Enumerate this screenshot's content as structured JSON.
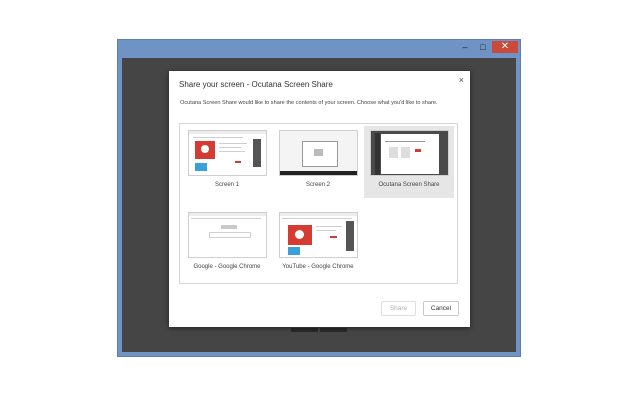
{
  "window": {
    "controls": {
      "minimize": "–",
      "maximize": "□",
      "close": "✕"
    }
  },
  "dialog": {
    "title": "Share your screen - Ocutana Screen Share",
    "close_glyph": "×",
    "description": "Ocutana Screen Share would like to share the contents of your screen. Choose what you'd like to share.",
    "sources": [
      {
        "label": "Screen 1",
        "selected": false
      },
      {
        "label": "Screen 2",
        "selected": false
      },
      {
        "label": "Ocutana Screen Share",
        "selected": true
      },
      {
        "label": "Google - Google Chrome",
        "selected": false
      },
      {
        "label": "YouTube - Google Chrome",
        "selected": false
      }
    ],
    "share_label": "Share",
    "cancel_label": "Cancel"
  },
  "colors": {
    "window_frame": "#6f93c4",
    "client_bg": "#454545",
    "close_button": "#c94a3a",
    "thumb_accent": "#d63b33"
  }
}
